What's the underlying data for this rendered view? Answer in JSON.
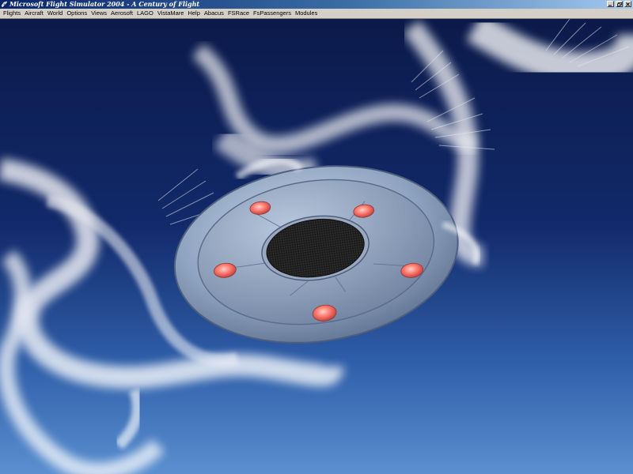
{
  "window": {
    "title": "Microsoft Flight Simulator 2004 - A Century of Flight",
    "app_icon": "fs-app-icon",
    "controls": {
      "minimize": "minimize-icon",
      "maximize": "restore-icon",
      "close": "close-icon"
    }
  },
  "menubar": {
    "items": [
      {
        "label": "Flights"
      },
      {
        "label": "Aircraft"
      },
      {
        "label": "World"
      },
      {
        "label": "Options"
      },
      {
        "label": "Views"
      },
      {
        "label": "Aerosoft"
      },
      {
        "label": "LAGO"
      },
      {
        "label": "VistaMare"
      },
      {
        "label": "Help"
      },
      {
        "label": "Abacus"
      },
      {
        "label": "FSRace"
      },
      {
        "label": "FsPassengers"
      },
      {
        "label": "Modules"
      }
    ]
  },
  "scene": {
    "subject": "flying-saucer",
    "colors": {
      "sky_top": "#0b1a4a",
      "sky_bottom": "#4f86c9",
      "saucer_rim": "#8fa4c0",
      "saucer_lights": "#ff7a6e",
      "center_grille": "#1a1a1a",
      "trails": "#ffffff"
    }
  }
}
